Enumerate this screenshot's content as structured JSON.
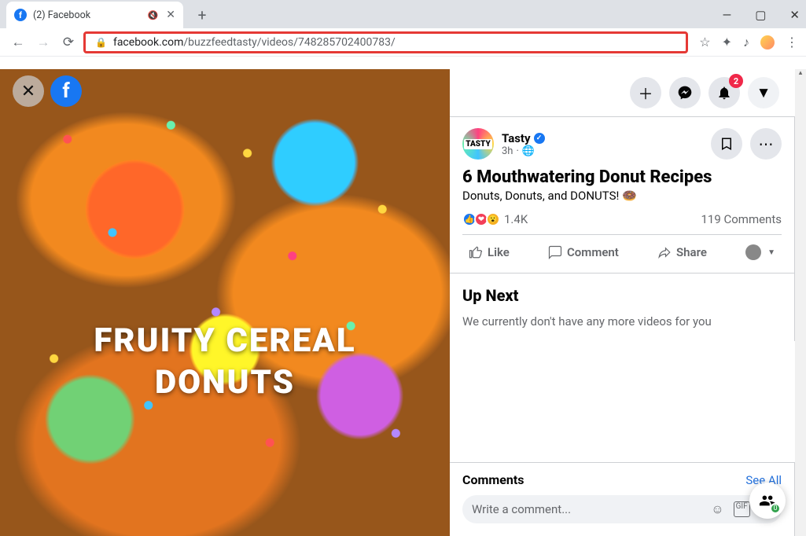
{
  "browser": {
    "tab_title": "(2) Facebook",
    "url_host": "facebook.com",
    "url_path": "/buzzfeedtasty/videos/748285702400783/",
    "notification_badge": "2"
  },
  "video_overlay": {
    "line1": "FRUITY CEREAL",
    "line2": "DONUTS"
  },
  "post": {
    "author": "Tasty",
    "avatar_text": "TASTY",
    "time": "3h",
    "privacy": "🌐",
    "title": "6 Mouthwatering Donut Recipes",
    "description": "Donuts, Donuts, and DONUTS! 🍩",
    "reaction_count": "1.4K",
    "comment_count": "119 Comments",
    "like_label": "Like",
    "comment_label": "Comment",
    "share_label": "Share"
  },
  "upnext": {
    "heading": "Up Next",
    "empty_msg": "We currently don't have any more videos for you"
  },
  "comments": {
    "heading": "Comments",
    "see_all": "See All",
    "placeholder": "Write a comment..."
  },
  "fab_count": "0"
}
